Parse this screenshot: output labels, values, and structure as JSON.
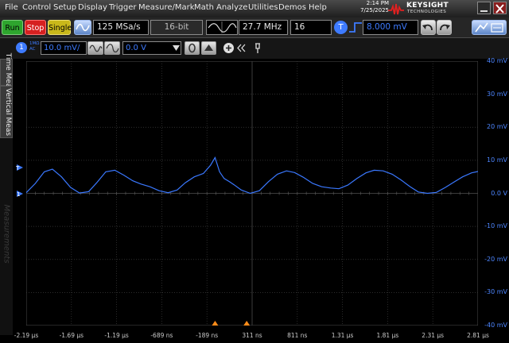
{
  "menu": {
    "items": [
      "File",
      "Control",
      "Setup",
      "Display",
      "Trigger",
      "Measure/Mark",
      "Math",
      "Analyze",
      "Utilities",
      "Demos",
      "Help"
    ]
  },
  "clock": {
    "time": "2:14 PM",
    "date": "7/25/2025"
  },
  "brand": {
    "name": "KEYSIGHT",
    "sub": "TECHNOLOGIES"
  },
  "toolbar": {
    "run": "Run",
    "stop": "Stop",
    "single": "Single",
    "sample_rate": "125 MSa/s",
    "bits": "16-bit",
    "frequency": "27.7 MHz",
    "averages": "16",
    "trigger_badge": "T",
    "trigger_level": "8.000 mV"
  },
  "channel": {
    "label": "1",
    "coupling_top": "1MΩ",
    "coupling_bottom": "AC",
    "scale": "10.0 mV/",
    "offset": "0.0 V"
  },
  "sidebar": {
    "tabs": [
      "Time Meas",
      "Vertical Meas"
    ],
    "measurements": "Measurements"
  },
  "colors": {
    "trace": "#3a78ff",
    "axis_text": "#4d86ff",
    "grid": "#3c3c3c",
    "trigger_marker": "#ff8c1a"
  },
  "chart_data": {
    "type": "line",
    "y_tick_labels": [
      "40 mV",
      "30 mV",
      "20 mV",
      "10 mV",
      "0.0 V",
      "-10 mV",
      "-20 mV",
      "-30 mV",
      "-40 mV"
    ],
    "x_tick_labels": [
      "-2.19 µs",
      "-1.69 µs",
      "-1.19 µs",
      "-689 ns",
      "-189 ns",
      "311 ns",
      "811 ns",
      "1.31 µs",
      "1.81 µs",
      "2.31 µs",
      "2.81 µs"
    ],
    "xlim_us": [
      -2.19,
      2.81
    ],
    "ylim_mV": [
      -40,
      40
    ],
    "series": [
      {
        "x_us": [
          -2.19,
          -2.09,
          -1.99,
          -1.9,
          -1.8,
          -1.7,
          -1.6,
          -1.5,
          -1.41,
          -1.31,
          -1.21,
          -1.11,
          -1.01,
          -0.92,
          -0.82,
          -0.72,
          -0.62,
          -0.52,
          -0.43,
          -0.33,
          -0.23,
          -0.15,
          -0.1,
          -0.05,
          0.0,
          0.06,
          0.11,
          0.19,
          0.29,
          0.39,
          0.49,
          0.59,
          0.69,
          0.78,
          0.88,
          0.98,
          1.08,
          1.18,
          1.27,
          1.37,
          1.47,
          1.57,
          1.66,
          1.76,
          1.86,
          1.96,
          2.06,
          2.15,
          2.25,
          2.35,
          2.45,
          2.55,
          2.64,
          2.74,
          2.81
        ],
        "y_mV": [
          0.2,
          3.0,
          6.5,
          7.3,
          5.0,
          1.8,
          0.1,
          0.5,
          3.2,
          6.5,
          7.0,
          5.5,
          3.8,
          2.8,
          2.0,
          0.8,
          0.2,
          1.0,
          3.2,
          5.0,
          6.0,
          8.5,
          10.8,
          6.5,
          4.5,
          3.5,
          2.6,
          1.0,
          0.0,
          0.8,
          3.5,
          5.8,
          6.8,
          6.3,
          4.8,
          3.0,
          2.0,
          1.6,
          1.4,
          2.5,
          4.5,
          6.2,
          7.0,
          6.8,
          5.8,
          4.0,
          2.0,
          0.4,
          0.0,
          0.3,
          1.8,
          3.5,
          5.0,
          6.2,
          6.6
        ]
      }
    ],
    "trigger_level_mV": 8.0
  }
}
